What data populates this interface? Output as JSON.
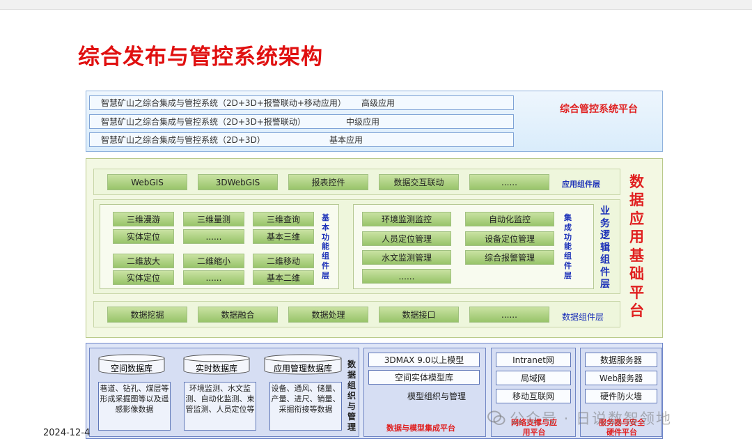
{
  "title": "综合发布与管控系统架构",
  "date": "2024-12-4",
  "top": {
    "platform_label": "综合管控系统平台",
    "rows": [
      {
        "text": "智慧矿山之综合集成与管控系统（2D+3D+报警联动+移动应用）",
        "level": "高级应用"
      },
      {
        "text": "智慧矿山之综合集成与管控系统（2D+3D+报警联动）",
        "level": "中级应用"
      },
      {
        "text": "智慧矿山之综合集成与管控系统（2D+3D）",
        "level": "基本应用"
      }
    ]
  },
  "mid": {
    "platform_label": [
      "数",
      "据",
      "应",
      "用",
      "基",
      "础",
      "平",
      "台"
    ],
    "app_layer": {
      "label": "应用组件层",
      "items": [
        "WebGIS",
        "3DWebGIS",
        "报表控件",
        "数据交互联动",
        "......"
      ]
    },
    "basic": {
      "label": [
        "基",
        "本",
        "功",
        "能",
        "组",
        "件",
        "层"
      ],
      "col1": [
        "三维漫游",
        "实体定位",
        "二维放大",
        "实体定位"
      ],
      "col2": [
        "三维量测",
        "......",
        "二维缩小",
        "......"
      ],
      "col3": [
        "三维查询",
        "基本三维",
        "二维移动",
        "基本二维"
      ]
    },
    "integrated": {
      "label": [
        "集",
        "成",
        "功",
        "能",
        "组",
        "件",
        "层"
      ],
      "col1": [
        "环境监测监控",
        "人员定位管理",
        "水文监测管理",
        "......"
      ],
      "col2": [
        "自动化监控",
        "设备定位管理",
        "综合报警管理"
      ]
    },
    "logic_label": [
      "业",
      "务",
      "逻",
      "辑",
      "组",
      "件",
      "层"
    ],
    "data_layer": {
      "label": "数据组件层",
      "items": [
        "数据挖掘",
        "数据融合",
        "数据处理",
        "数据接口",
        "......"
      ]
    }
  },
  "bot": {
    "databases": [
      "空间数据库",
      "实时数据库",
      "应用管理数据库"
    ],
    "db_contents": [
      "巷道、钻孔、煤层等形成采掘图等以及遥感影像数据",
      "环境监测、水文监测、自动化监测、束管监测、人员定位等",
      "设备、通风、储量、产量、进尺、销量、采掘衔接等数据"
    ],
    "org_label": [
      "数",
      "据",
      "组",
      "织",
      "与",
      "管",
      "理"
    ],
    "model": {
      "items": [
        "3DMAX 9.0以上模型",
        "空间实体模型库"
      ],
      "sub": "模型组织与管理",
      "label": "数据与模型集成平台"
    },
    "network": {
      "items": [
        "Intranet网",
        "局域网",
        "移动互联网"
      ],
      "label": [
        "网络支撑与应",
        "用平台"
      ]
    },
    "server": {
      "items": [
        "数据服务器",
        "Web服务器",
        "硬件防火墙"
      ],
      "label": [
        "服务器与安全",
        "硬件平台"
      ]
    }
  },
  "watermark": "公众号 · 日说数智领地",
  "colors": {
    "title_red": "#e01010",
    "layer_blue": "#1a2fb8",
    "button_green": "#98c46a"
  }
}
